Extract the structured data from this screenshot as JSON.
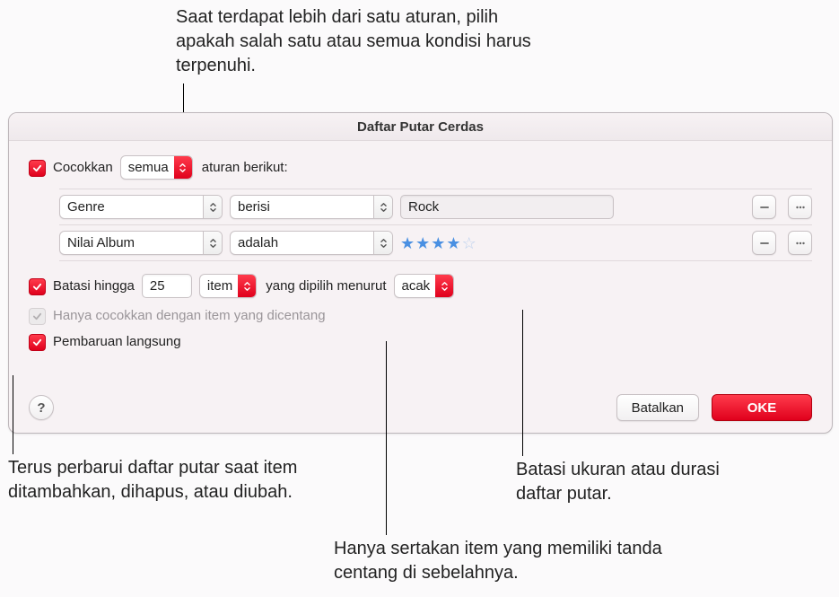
{
  "callouts": {
    "top": "Saat terdapat lebih dari satu aturan, pilih apakah salah satu atau semua kondisi harus terpenuhi.",
    "bottom_left": "Terus perbarui daftar putar saat item ditambahkan, dihapus, atau diubah.",
    "bottom_mid": "Hanya sertakan item yang memiliki tanda centang di sebelahnya.",
    "bottom_right": "Batasi ukuran atau durasi daftar putar."
  },
  "window": {
    "title": "Daftar Putar Cerdas"
  },
  "match": {
    "label_left": "Cocokkan",
    "popup": "semua",
    "label_right": "aturan berikut:"
  },
  "rules": [
    {
      "field": "Genre",
      "op": "berisi",
      "value": "Rock",
      "type": "text"
    },
    {
      "field": "Nilai Album",
      "op": "adalah",
      "stars": 4,
      "type": "stars"
    }
  ],
  "limit": {
    "label": "Batasi hingga",
    "value": "25",
    "unit": "item",
    "by_label": "yang dipilih menurut",
    "by_value": "acak"
  },
  "only_checked": {
    "label": "Hanya cocokkan dengan item yang dicentang"
  },
  "live_update": {
    "label": "Pembaruan langsung"
  },
  "buttons": {
    "cancel": "Batalkan",
    "ok": "OKE",
    "help": "?"
  }
}
